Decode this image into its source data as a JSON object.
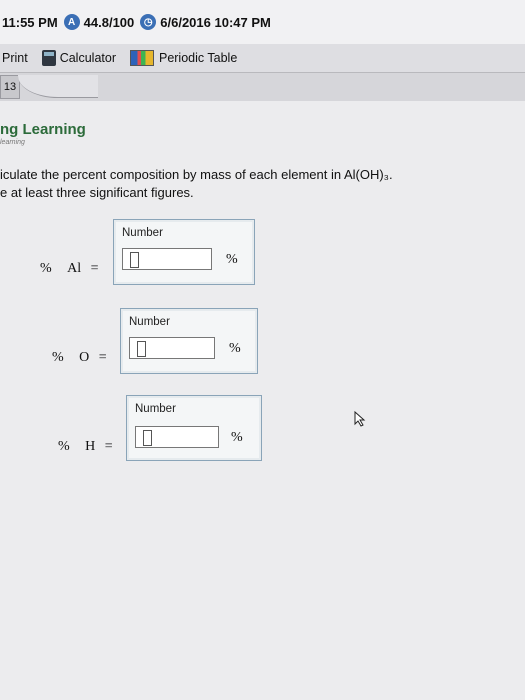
{
  "status": {
    "time": "11:55 PM",
    "score": "44.8/100",
    "datetime": "6/6/2016 10:47 PM",
    "score_icon": "a-badge-icon",
    "clock_icon": "clock-icon"
  },
  "toolbar": {
    "print_label": "Print",
    "calculator_label": "Calculator",
    "periodic_table_label": "Periodic Table"
  },
  "tab": {
    "label": "13"
  },
  "brand": {
    "title": "ng Learning",
    "subtitle": "learning"
  },
  "question": {
    "line1": "iculate the percent composition by mass of each element in Al(OH)₃.",
    "line2": "e at least three significant figures."
  },
  "answers": [
    {
      "prefix": "%",
      "element": "Al",
      "eq": "=",
      "box_label": "Number",
      "value": "",
      "unit": "%"
    },
    {
      "prefix": "%",
      "element": "O",
      "eq": "=",
      "box_label": "Number",
      "value": "",
      "unit": "%"
    },
    {
      "prefix": "%",
      "element": "H",
      "eq": "=",
      "box_label": "Number",
      "value": "",
      "unit": "%"
    }
  ]
}
